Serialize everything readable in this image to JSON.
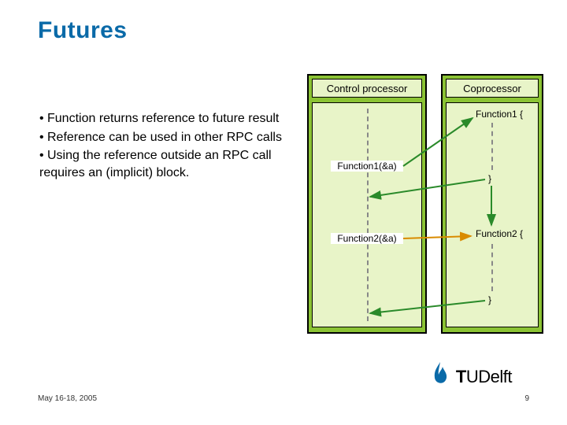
{
  "title": "Futures",
  "bullets": [
    "Function returns reference to future result",
    "Reference can be used in other RPC calls",
    "Using the reference outside an RPC call requires an (implicit) block."
  ],
  "control": {
    "header": "Control processor",
    "calls": [
      "Function1(&a)",
      "Function2(&a)"
    ]
  },
  "coprocessor": {
    "header": "Coprocessor",
    "fn1_open": "Function1 {",
    "fn1_close": "}",
    "fn2_open": "Function2 {",
    "fn2_close": "}"
  },
  "footer": {
    "date": "May 16-18, 2005",
    "page": "9"
  },
  "logo": {
    "text_pre": "T",
    "text_post": "UDelft"
  }
}
